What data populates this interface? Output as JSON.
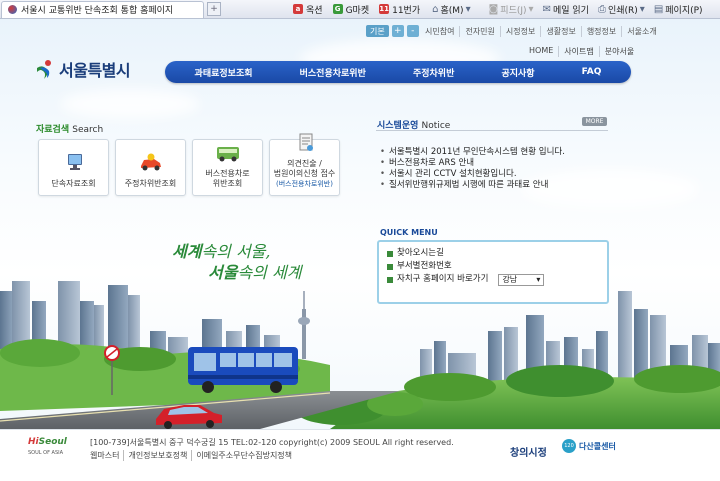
{
  "browser": {
    "tab_title": "서울시 교통위반 단속조회 통합 홈페이지",
    "new_tab": "+",
    "favorites": [
      {
        "label": "옥션",
        "color": "#d43a3a",
        "icon": "auction-icon"
      },
      {
        "label": "G마켓",
        "color": "#3a9a3a",
        "icon": "gmarket-icon"
      },
      {
        "label": "11번가",
        "color": "#d43a3a",
        "icon": "11st-icon"
      }
    ],
    "tools": [
      {
        "label": "홈(M)",
        "icon": "home-icon",
        "enabled": true
      },
      {
        "label": "피드(J)",
        "icon": "feed-icon",
        "enabled": false
      },
      {
        "label": "메일 읽기",
        "icon": "mail-icon",
        "enabled": true
      },
      {
        "label": "인쇄(R)",
        "icon": "print-icon",
        "enabled": true
      },
      {
        "label": "페이지(P)",
        "icon": "page-icon",
        "enabled": true
      }
    ]
  },
  "utility": {
    "basic_label": "기본",
    "zoom_in": "+",
    "zoom_out": "-",
    "links": [
      "시민참여",
      "전자민원",
      "시정정보",
      "생활정보",
      "행정정보",
      "서울소개"
    ],
    "sub_links": [
      "HOME",
      "사이트맵",
      "분야서울"
    ]
  },
  "logo": {
    "text": "서울특별시"
  },
  "nav": [
    "과태료정보조회",
    "버스전용차로위반",
    "주정차위반",
    "공지사항",
    "FAQ"
  ],
  "search": {
    "title": "자료검색",
    "title_en": "Search",
    "cards": [
      {
        "label": "단속자료조회",
        "icon": "monitor-icon"
      },
      {
        "label": "주정차위반조회",
        "icon": "car-icon"
      },
      {
        "label": "버스전용차로 위반조회",
        "label1": "버스전용차로",
        "label2": "위반조회",
        "icon": "bus-lane-icon"
      },
      {
        "label1": "의견진술 /",
        "label2": "법원이의신청 접수",
        "sub": "(버스전용차로위반)",
        "icon": "document-icon"
      }
    ]
  },
  "notice": {
    "title": "시스템운영",
    "title_en": "Notice",
    "more": "MORE",
    "items": [
      "서울특별시 2011년 무인단속시스템 현황 입니다.",
      "버스전용차로 ARS 안내",
      "서울시 관리 CCTV 설치현황입니다.",
      "질서위반행위규제법 시행에 따른 과태료 안내"
    ]
  },
  "quick": {
    "title": "QUICK MENU",
    "items": [
      "찾아오시는길",
      "부서별전화번호",
      "자치구 홈페이지 바로가기"
    ],
    "district_select": "강남"
  },
  "slogan": {
    "line1_a": "세계",
    "line1_b": "속의 서울,",
    "line2_a": "서울",
    "line2_b": "속의 세계"
  },
  "footer": {
    "logo_top_a": "Hi",
    "logo_top_b": "Seoul",
    "logo_bottom": "SOUL OF ASIA",
    "address": "[100-739]서울특별시 중구 덕수궁길 15 TEL:02-120 copyright(c) 2009 SEOUL All right reserved.",
    "links": [
      "웹마스터",
      "개인정보보호정책",
      "이메일주소무단수집방지정책"
    ],
    "badge1": "창의시정",
    "badge2_circle": "120",
    "badge2_text": "다산콜센터"
  },
  "colors": {
    "nav_bg": "#1a49a6",
    "search_title": "#2a8a2a",
    "notice_title": "#1a4a99",
    "slogan": "#2a8a3a",
    "bus": "#1a4bbd",
    "car": "#d4202a"
  }
}
